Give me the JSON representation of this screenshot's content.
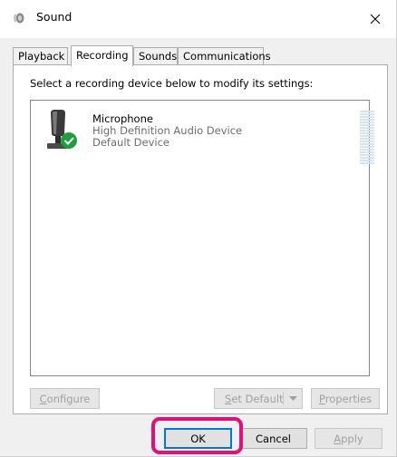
{
  "window": {
    "title": "Sound",
    "close_glyph": "✕"
  },
  "tabs": [
    {
      "label": "Playback",
      "active": false
    },
    {
      "label": "Recording",
      "active": true
    },
    {
      "label": "Sounds",
      "active": false
    },
    {
      "label": "Communications",
      "active": false
    }
  ],
  "panel": {
    "instruction": "Select a recording device below to modify its settings:"
  },
  "devices": [
    {
      "name": "Microphone",
      "description": "High Definition Audio Device",
      "status": "Default Device",
      "icon": "microphone-icon",
      "badge": "green-check-icon"
    }
  ],
  "buttons": {
    "configure": {
      "pre": "",
      "accel": "C",
      "post": "onfigure",
      "enabled": false
    },
    "set_default": {
      "pre": "",
      "accel": "S",
      "post": "et Default",
      "enabled": false
    },
    "properties": {
      "pre": "",
      "accel": "P",
      "post": "roperties",
      "enabled": false
    },
    "ok": {
      "label": "OK",
      "enabled": true
    },
    "cancel": {
      "label": "Cancel",
      "enabled": true
    },
    "apply": {
      "pre": "",
      "accel": "A",
      "post": "pply",
      "enabled": false
    }
  },
  "colors": {
    "highlight": "#e0127a",
    "check_green": "#1e9e3c",
    "meter": "#d3e6f0"
  }
}
